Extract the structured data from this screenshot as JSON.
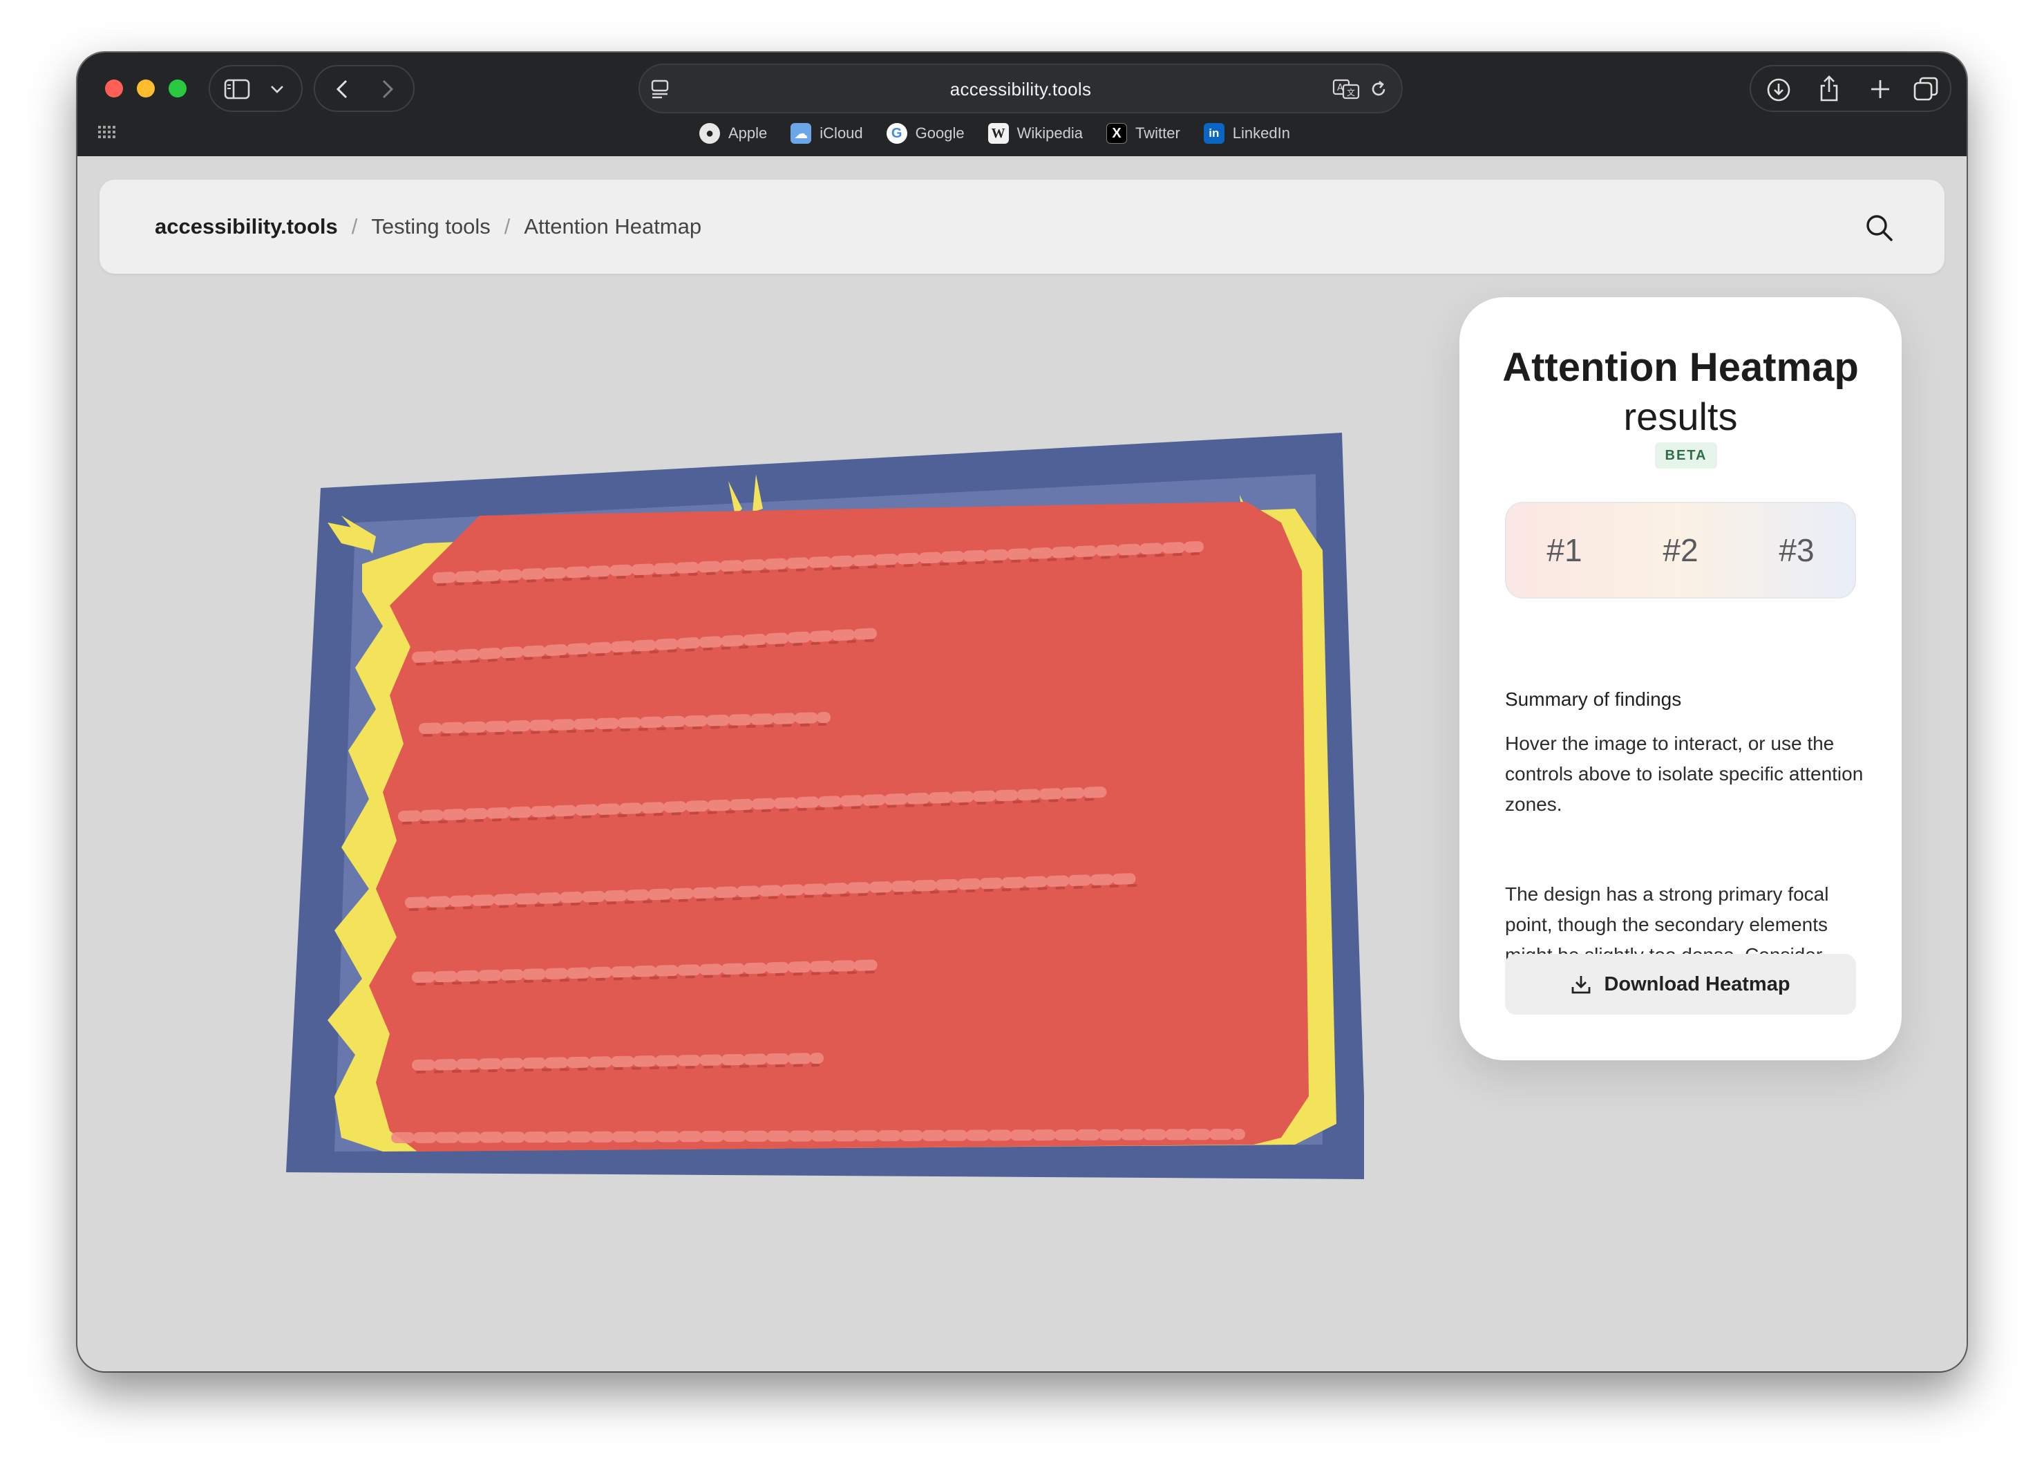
{
  "browser": {
    "url": "accessibility.tools",
    "bookmarks": [
      {
        "label": "Apple",
        "icon": "apple-icon"
      },
      {
        "label": "iCloud",
        "icon": "icloud-icon"
      },
      {
        "label": "Google",
        "icon": "google-icon"
      },
      {
        "label": "Wikipedia",
        "icon": "wikipedia-icon"
      },
      {
        "label": "Twitter",
        "icon": "twitter-x-icon"
      },
      {
        "label": "LinkedIn",
        "icon": "linkedin-icon"
      }
    ]
  },
  "header": {
    "breadcrumb": [
      "accessibility.tools",
      "Testing tools",
      "Attention Heatmap"
    ],
    "separator": "/"
  },
  "panel": {
    "title": "Attention Heatmap",
    "subtitle": "results",
    "badge": "BETA",
    "zones": [
      "#1",
      "#2",
      "#3"
    ],
    "summary_heading": "Summary of findings",
    "paragraphs": [
      "Hover the image to interact, or use the controls above to isolate specific attention zones.",
      "The design has a strong primary focal point, though the secondary elements might be slightly too dense. Consider simplifying the middle hierarchy."
    ],
    "download_label": "Download Heatmap"
  },
  "colors": {
    "heat_primary": "#e05a52",
    "heat_secondary": "#f2e35a",
    "heat_base": "#4f6196",
    "beta_bg": "#e7f4ec",
    "beta_text": "#2f6d48"
  }
}
